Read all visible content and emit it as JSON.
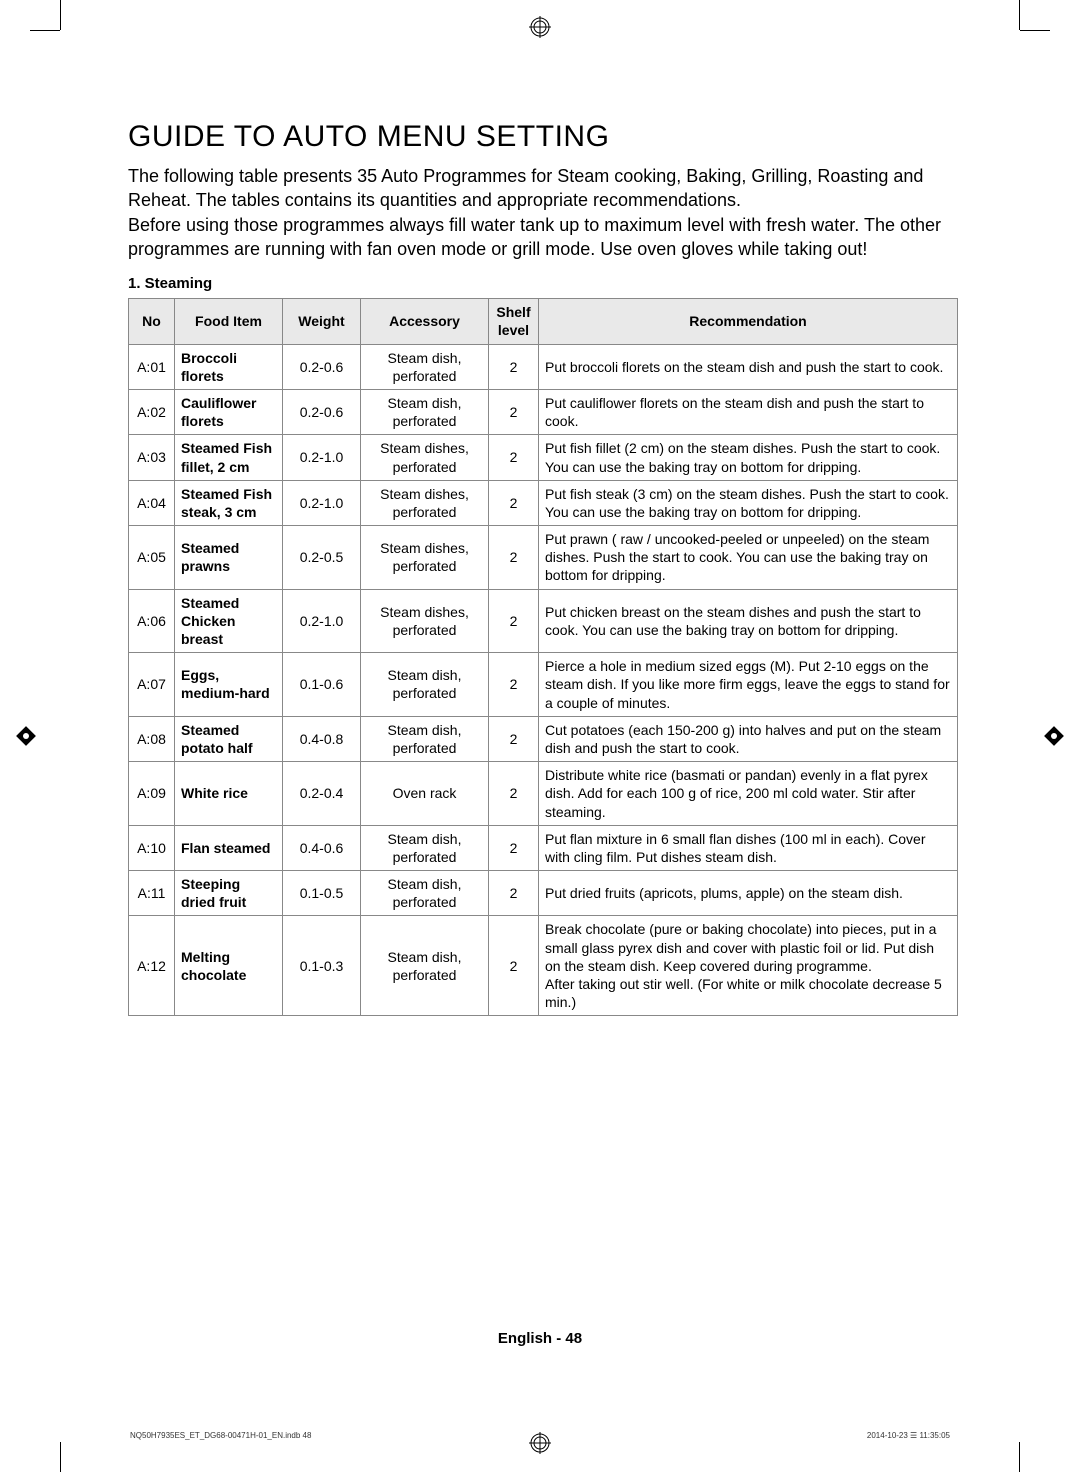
{
  "title": "GUIDE TO AUTO MENU SETTING",
  "intro": "The following table presents 35 Auto Programmes for Steam cooking, Baking, Grilling, Roasting and Reheat. The tables contains its quantities and appropriate recommendations.\nBefore using those programmes always fill water tank up to maximum level with fresh water. The other programmes are running with fan oven mode or grill mode. Use oven gloves while taking out!",
  "section_heading": "1. Steaming",
  "headers": {
    "no": "No",
    "item": "Food Item",
    "weight": "Weight",
    "accessory": "Accessory",
    "shelf": "Shelf level",
    "rec": "Recommendation"
  },
  "rows": [
    {
      "no": "A:01",
      "item": "Broccoli florets",
      "weight": "0.2-0.6",
      "acc": "Steam dish, perforated",
      "shelf": "2",
      "rec": "Put broccoli florets on the steam dish and push the start to cook."
    },
    {
      "no": "A:02",
      "item": "Cauliflower florets",
      "weight": "0.2-0.6",
      "acc": "Steam dish, perforated",
      "shelf": "2",
      "rec": "Put cauliflower florets on the steam dish and push the start to cook."
    },
    {
      "no": "A:03",
      "item": "Steamed Fish fillet, 2 cm",
      "weight": "0.2-1.0",
      "acc": "Steam dishes, perforated",
      "shelf": "2",
      "rec": "Put fish fillet (2 cm) on the steam dishes. Push the start to cook. You can use the baking tray on bottom for dripping."
    },
    {
      "no": "A:04",
      "item": "Steamed Fish steak, 3 cm",
      "weight": "0.2-1.0",
      "acc": "Steam dishes, perforated",
      "shelf": "2",
      "rec": "Put fish steak (3 cm) on the steam dishes. Push the start to cook. You can use the baking tray on bottom for dripping."
    },
    {
      "no": "A:05",
      "item": "Steamed prawns",
      "weight": "0.2-0.5",
      "acc": "Steam dishes, perforated",
      "shelf": "2",
      "rec": "Put prawn ( raw / uncooked-peeled or unpeeled) on the steam dishes. Push the start to cook. You can use the baking tray on bottom for dripping."
    },
    {
      "no": "A:06",
      "item": "Steamed Chicken breast",
      "weight": "0.2-1.0",
      "acc": "Steam dishes, perforated",
      "shelf": "2",
      "rec": "Put chicken breast on the steam dishes and push the start to cook. You can use the baking tray on bottom for dripping."
    },
    {
      "no": "A:07",
      "item": "Eggs, medium-hard",
      "weight": "0.1-0.6",
      "acc": "Steam dish, perforated",
      "shelf": "2",
      "rec": "Pierce a hole in medium sized eggs (M). Put 2-10 eggs on the steam dish. If you like more firm eggs, leave the eggs to stand for a couple of minutes."
    },
    {
      "no": "A:08",
      "item": "Steamed potato half",
      "weight": "0.4-0.8",
      "acc": "Steam dish, perforated",
      "shelf": "2",
      "rec": "Cut potatoes (each 150-200 g) into halves and put on the steam dish and push the start to cook."
    },
    {
      "no": "A:09",
      "item": "White rice",
      "weight": "0.2-0.4",
      "acc": "Oven rack",
      "shelf": "2",
      "rec": "Distribute white rice (basmati or pandan) evenly in a flat pyrex dish. Add for each 100 g of rice, 200 ml cold water. Stir after steaming."
    },
    {
      "no": "A:10",
      "item": "Flan steamed",
      "weight": "0.4-0.6",
      "acc": "Steam dish, perforated",
      "shelf": "2",
      "rec": "Put flan mixture in 6 small flan dishes (100 ml in each). Cover with cling film. Put dishes steam dish."
    },
    {
      "no": "A:11",
      "item": "Steeping dried fruit",
      "weight": "0.1-0.5",
      "acc": "Steam dish, perforated",
      "shelf": "2",
      "rec": "Put dried fruits (apricots, plums, apple) on the steam dish."
    },
    {
      "no": "A:12",
      "item": "Melting chocolate",
      "weight": "0.1-0.3",
      "acc": "Steam dish, perforated",
      "shelf": "2",
      "rec": "Break chocolate (pure or baking chocolate) into pieces, put in a small glass pyrex dish and cover with plastic foil or lid. Put dish on the steam dish. Keep covered during programme.\nAfter taking out stir well. (For white or milk chocolate decrease 5 min.)"
    }
  ],
  "footer": {
    "lang": "English - ",
    "page": "48",
    "print_left": "NQ50H7935ES_ET_DG68-00471H-01_EN.indb   48",
    "print_right": "2014-10-23   ☰ 11:35:05"
  }
}
